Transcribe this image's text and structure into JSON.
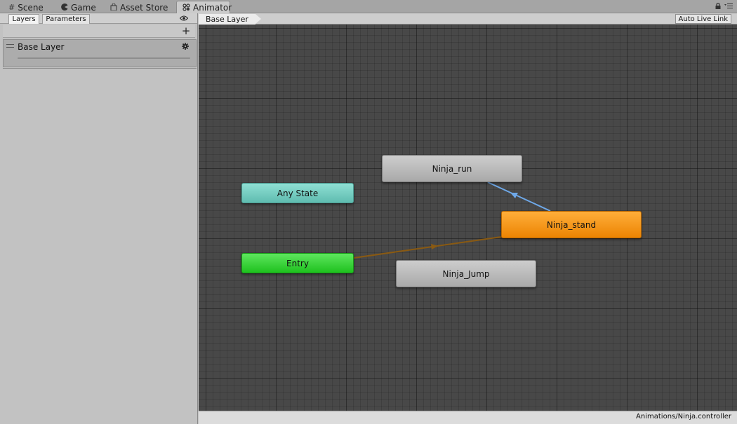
{
  "tabs": [
    {
      "label": "Scene",
      "icon": "grid-icon"
    },
    {
      "label": "Game",
      "icon": "pacman-icon"
    },
    {
      "label": "Asset Store",
      "icon": "shopping-bag-icon"
    },
    {
      "label": "Animator",
      "icon": "animator-icon",
      "active": true
    }
  ],
  "tabbar_right": {
    "icons": [
      "lock-icon",
      "menu-icon"
    ]
  },
  "left_panel": {
    "tabs": [
      {
        "label": "Layers",
        "active": true
      },
      {
        "label": "Parameters"
      }
    ],
    "add_label": "+",
    "layers": [
      {
        "name": "Base Layer",
        "weight": 1.0
      }
    ]
  },
  "graph": {
    "breadcrumb": "Base Layer",
    "auto_live_link_label": "Auto Live Link",
    "states": {
      "any_state": "Any State",
      "entry": "Entry",
      "run": "Ninja_run",
      "stand": "Ninja_stand",
      "jump": "Ninja_Jump"
    },
    "transitions": [
      {
        "from": "Entry",
        "to": "Ninja_stand",
        "kind": "default",
        "color": "#8a5a12"
      },
      {
        "from": "Ninja_stand",
        "to": "Ninja_run",
        "kind": "transition",
        "color": "#6ea8e8"
      }
    ],
    "colors": {
      "any_state": "#6fc9bd",
      "entry": "#2fcf2f",
      "default_state": "#f28c0c",
      "state": "#b9b9b9",
      "background": "#484848"
    }
  },
  "status_bar": {
    "path": "Animations/Ninja.controller"
  }
}
